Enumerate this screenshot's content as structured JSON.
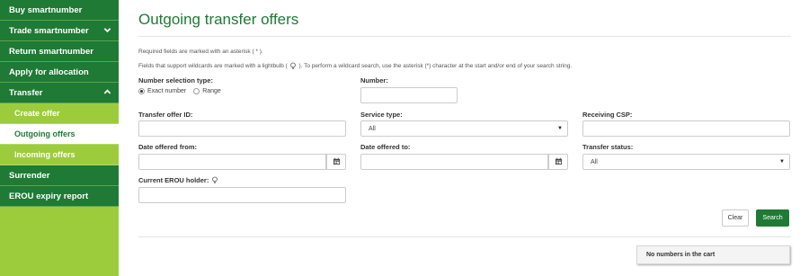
{
  "sidebar": {
    "items": [
      {
        "label": "Buy smartnumber",
        "chevron": ""
      },
      {
        "label": "Trade smartnumber",
        "chevron": "❯"
      },
      {
        "label": "Return smartnumber",
        "chevron": ""
      },
      {
        "label": "Apply for allocation",
        "chevron": ""
      },
      {
        "label": "Transfer",
        "chevron": "❯"
      }
    ],
    "sub_items": [
      {
        "label": "Create offer"
      },
      {
        "label": "Outgoing offers"
      },
      {
        "label": "Incoming offers"
      }
    ],
    "items_after": [
      {
        "label": "Surrender"
      },
      {
        "label": "EROU expiry report"
      }
    ]
  },
  "page": {
    "title": "Outgoing transfer offers",
    "required_note": "Required fields are marked with an asterisk ( * ).",
    "wildcard_note_pre": "Fields that support wildcards are marked with a lightbulb (",
    "wildcard_note_post": "). To perform a wildcard search, use the asterisk (*) character at the start and/or end of your search string."
  },
  "form": {
    "number_selection_type": {
      "label": "Number selection type:",
      "options": [
        "Exact number",
        "Range"
      ],
      "selected": "Exact number"
    },
    "number": {
      "label": "Number:",
      "value": ""
    },
    "transfer_offer_id": {
      "label": "Transfer offer ID:",
      "value": ""
    },
    "service_type": {
      "label": "Service type:",
      "value": "All"
    },
    "receiving_csp": {
      "label": "Receiving CSP:",
      "value": ""
    },
    "date_offered_from": {
      "label": "Date offered from:",
      "value": ""
    },
    "date_offered_to": {
      "label": "Date offered to:",
      "value": ""
    },
    "transfer_status": {
      "label": "Transfer status:",
      "value": "All"
    },
    "current_erou_holder": {
      "label": "Current EROU holder:",
      "value": ""
    }
  },
  "actions": {
    "clear_label": "Clear",
    "search_label": "Search"
  },
  "cart": {
    "text": "No numbers in the cart"
  },
  "colors": {
    "brand_green": "#1e7a34",
    "sidebar_light_green": "#9ccc3c"
  },
  "icons": [
    "chevron-down-icon",
    "chevron-up-icon",
    "calendar-icon",
    "lightbulb-icon",
    "select-arrow-icon"
  ]
}
